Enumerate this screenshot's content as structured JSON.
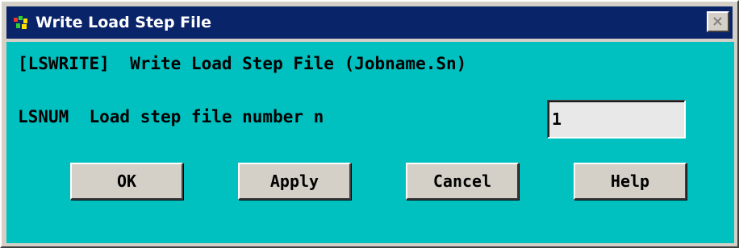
{
  "window": {
    "title": "Write Load Step File",
    "title_bar_color": "#0a246a",
    "client_color": "#00c0c0"
  },
  "titlebar": {
    "app_icon": "ansys-app-icon",
    "close_icon": "close-icon"
  },
  "dialog": {
    "command_line": "[LSWRITE]  Write Load Step File (Jobname.Sn)",
    "field": {
      "name": "LSNUM",
      "label": "LSNUM  Load step file number n",
      "value": "1"
    }
  },
  "buttons": {
    "ok": "OK",
    "apply": "Apply",
    "cancel": "Cancel",
    "help": "Help"
  }
}
